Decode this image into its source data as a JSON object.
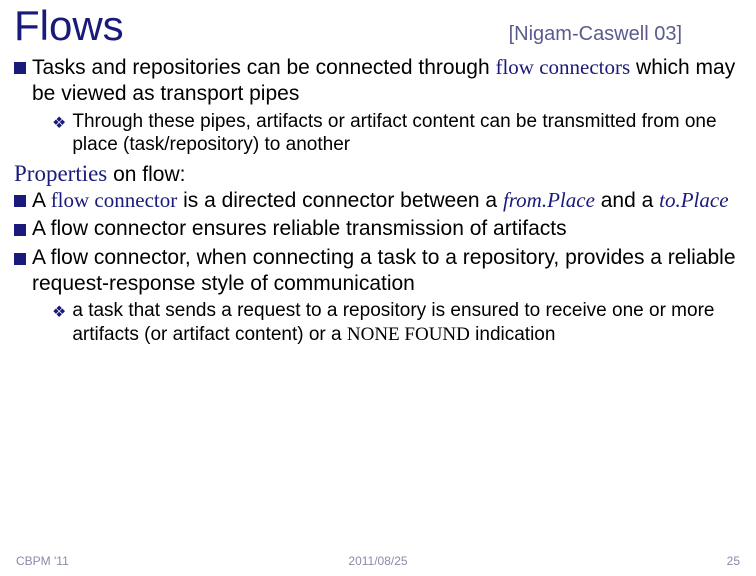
{
  "title": "Flows",
  "citation": "[Nigam-Caswell 03]",
  "bullet1_pre": "Tasks and repositories can be connected through ",
  "bullet1_kw": "flow connectors",
  "bullet1_post": " which may be viewed as transport pipes",
  "bullet1_sub": "Through these pipes, artifacts or artifact content can be transmitted from one place (task/repository) to another",
  "properties_pre": "Properties",
  "properties_post": " on flow:",
  "bullet2_pre": "A ",
  "bullet2_kw1": "flow connector",
  "bullet2_mid1": " is a directed connector between a ",
  "bullet2_from": "from.Place",
  "bullet2_mid2": " and a ",
  "bullet2_to": "to.Place",
  "bullet3": "A flow connector ensures reliable transmission of artifacts",
  "bullet4": "A flow connector, when connecting a task to a repository, provides a reliable request-response style of communication",
  "bullet4_sub_pre": "a task that sends a request to a repository is ensured to receive one or more artifacts (or artifact content) or a ",
  "bullet4_sub_kw": "NONE FOUND",
  "bullet4_sub_post": " indication",
  "footer_left": "CBPM '11",
  "footer_center": "2011/08/25",
  "footer_right": "25"
}
